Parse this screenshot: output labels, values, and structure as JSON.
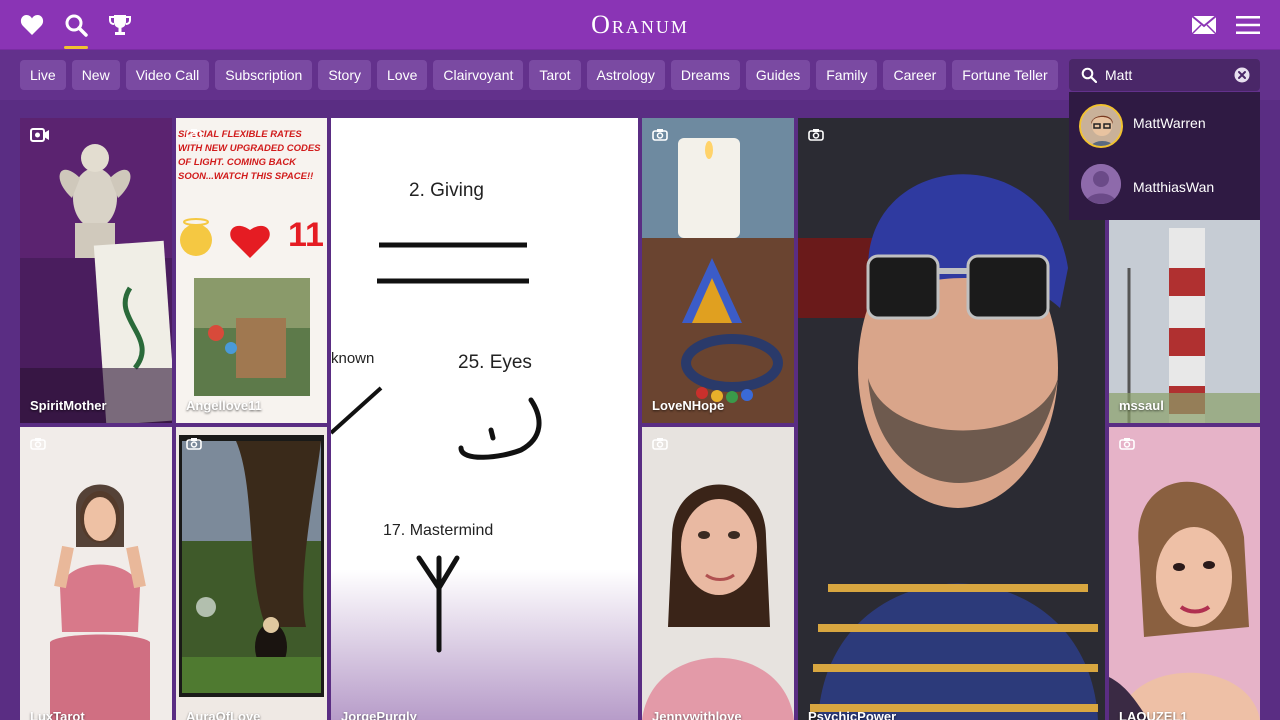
{
  "app": {
    "logo": "Oranum"
  },
  "nav": {
    "icons": [
      "heart-icon",
      "search-icon",
      "trophy-icon",
      "mail-icon",
      "menu-icon"
    ],
    "active": "search",
    "accent_color": "#f2c230"
  },
  "categories": [
    "Live",
    "New",
    "Video Call",
    "Subscription",
    "Story",
    "Love",
    "Clairvoyant",
    "Tarot",
    "Astrology",
    "Dreams",
    "Guides",
    "Family",
    "Career",
    "Fortune Teller"
  ],
  "search": {
    "value": "Matt",
    "results": [
      {
        "name": "MattWarren"
      },
      {
        "name": "MatthiasWan"
      }
    ]
  },
  "tiles": [
    {
      "name": "SpiritMother",
      "badge": "video-camera-icon"
    },
    {
      "name": "Angellove11",
      "badge": "camera-icon",
      "promo_text": "SPECIAL FLEXIBLE RATES WITH NEW UPGRADED CODES OF LIGHT. COMING BACK SOON...WATCH THIS SPACE!!",
      "number": "11"
    },
    {
      "name": "JorgePurgly",
      "badge": "",
      "drawing_labels": [
        "2. Giving",
        "known",
        "25. Eyes",
        "17. Mastermind"
      ]
    },
    {
      "name": "LoveNHope",
      "badge": "camera-icon"
    },
    {
      "name": "PsychicPower",
      "badge": "camera-icon"
    },
    {
      "name": "mssaul",
      "badge": "camera-icon"
    },
    {
      "name": "LuxTarot",
      "badge": "camera-icon"
    },
    {
      "name": "AuraOfLove",
      "badge": "camera-icon"
    },
    {
      "name": "Jennywithlove",
      "badge": "camera-icon"
    },
    {
      "name": "LAOUZEL1",
      "badge": "camera-icon"
    }
  ],
  "colors": {
    "topbar": "#8a34b5",
    "catbar": "#63318c",
    "chip": "#7a4aa2",
    "page_bg": "#5a2d83"
  }
}
